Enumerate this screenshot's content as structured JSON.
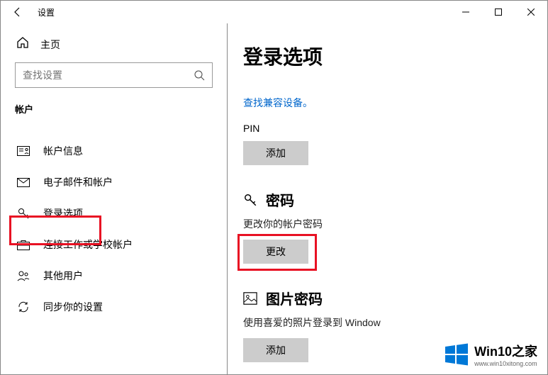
{
  "titlebar": {
    "title": "设置"
  },
  "sidebar": {
    "home": "主页",
    "search_placeholder": "查找设置",
    "section": "帐户",
    "items": [
      {
        "label": "帐户信息"
      },
      {
        "label": "电子邮件和帐户"
      },
      {
        "label": "登录选项"
      },
      {
        "label": "连接工作或学校帐户"
      },
      {
        "label": "其他用户"
      },
      {
        "label": "同步你的设置"
      }
    ]
  },
  "content": {
    "title": "登录选项",
    "compat_link": "查找兼容设备。",
    "pin_label": "PIN",
    "add_btn": "添加",
    "password": {
      "heading": "密码",
      "desc": "更改你的帐户密码",
      "btn": "更改"
    },
    "picture": {
      "heading": "图片密码",
      "desc": "使用喜爱的照片登录到 Window",
      "btn": "添加"
    }
  },
  "watermark": {
    "brand_a": "Win10",
    "brand_b": "之家",
    "url": "www.win10xitong.com"
  }
}
